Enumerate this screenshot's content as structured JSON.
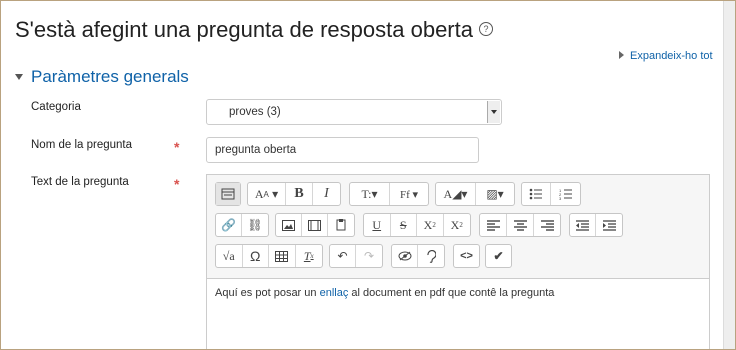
{
  "page": {
    "title": "S'està afegint una pregunta de resposta oberta"
  },
  "expand_all": "Expandeix-ho tot",
  "section": {
    "title": "Paràmetres generals"
  },
  "fields": {
    "category": {
      "label": "Categoria",
      "value": "proves (3)"
    },
    "question_name": {
      "label": "Nom de la pregunta",
      "value": "pregunta oberta",
      "required_mark": "*"
    },
    "question_text": {
      "label": "Text de la pregunta",
      "required_mark": "*"
    }
  },
  "editor": {
    "toolbar": [
      [
        "toggle-toolbar-icon",
        "font-size-icon",
        "bold-icon",
        "italic-icon",
        "text-style-icon",
        "font-family-icon",
        "text-color-icon",
        "background-color-icon",
        "bullet-list-icon",
        "numbered-list-icon"
      ],
      [
        "link-icon",
        "unlink-icon",
        "image-icon",
        "media-icon",
        "manage-files-icon",
        "underline-icon",
        "strikethrough-icon",
        "subscript-icon",
        "superscript-icon",
        "align-left-icon",
        "align-center-icon",
        "align-right-icon",
        "outdent-icon",
        "indent-icon"
      ],
      [
        "equation-icon",
        "special-character-icon",
        "table-icon",
        "clear-formatting-icon",
        "undo-icon",
        "redo-icon",
        "accessibility-checker-icon",
        "screenreader-helper-icon",
        "html-icon",
        "spellcheck-icon"
      ]
    ],
    "content": {
      "before": "Aquí es pot posar un ",
      "link": "enllaç",
      "after": " al document en pdf que contê la pregunta"
    }
  }
}
